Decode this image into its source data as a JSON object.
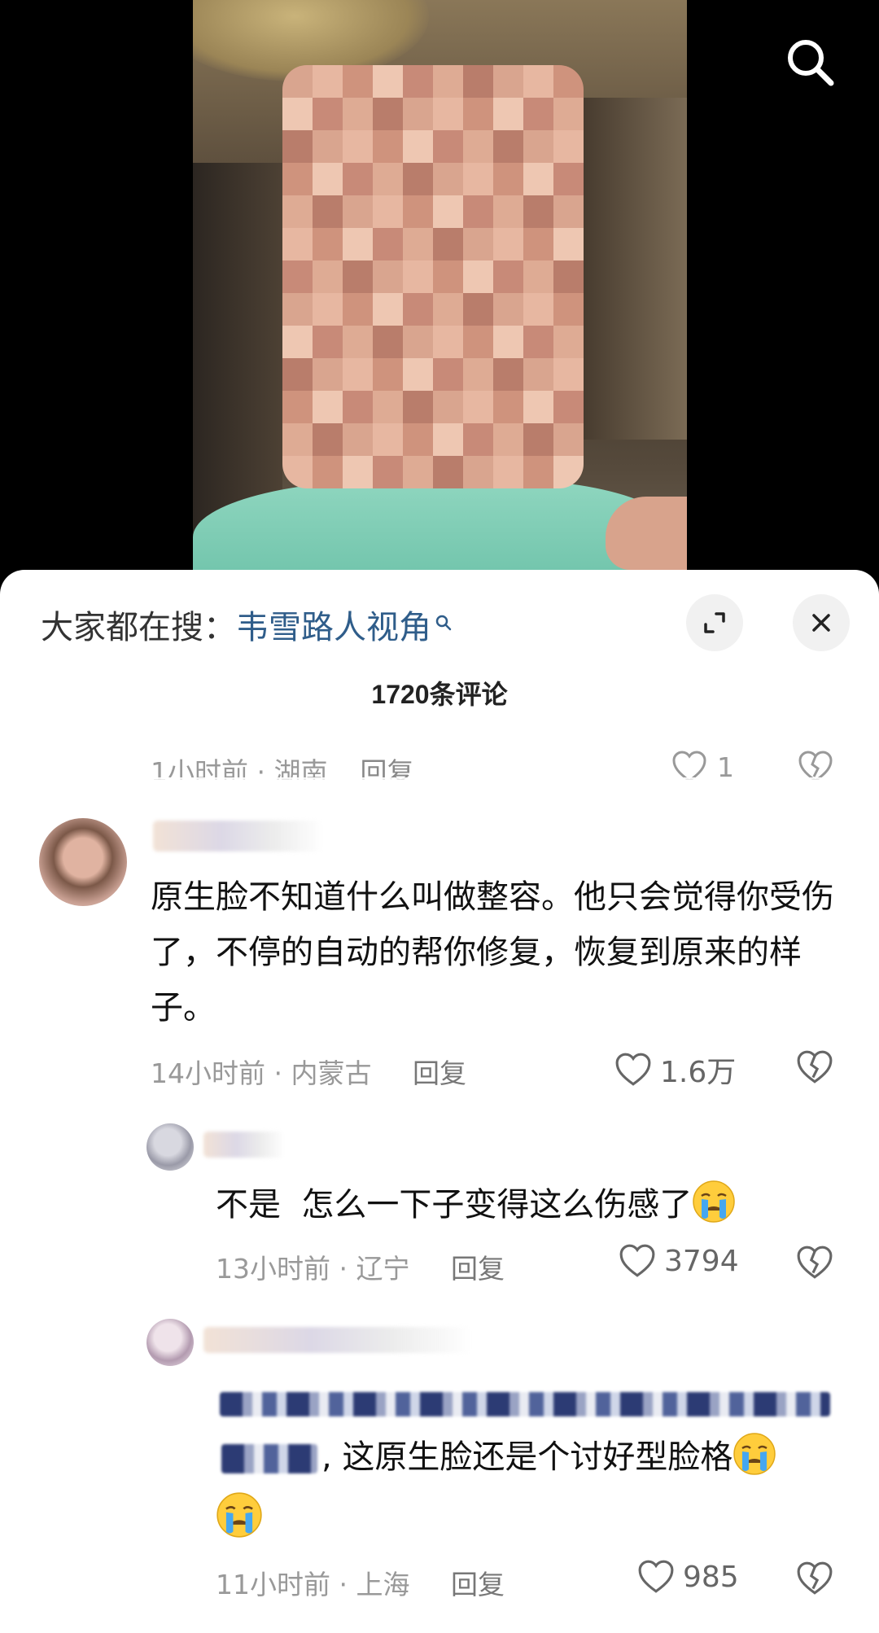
{
  "header": {
    "search_icon": "search-icon"
  },
  "panel": {
    "suggest_prefix": "大家都在搜：",
    "suggest_keyword": "韦雪路人视角",
    "title": "1720条评论",
    "expand_icon": "expand-icon",
    "close_icon": "close-icon"
  },
  "prev_comment_meta": {
    "time_loc": "1小时前 · 湖南",
    "reply": "回复",
    "likes": "1"
  },
  "comments": [
    {
      "text": "原生脸不知道什么叫做整容。他只会觉得你受伤了，不停的自动的帮你修复，恢复到原来的样子。",
      "time_loc": "14小时前 · 内蒙古",
      "reply": "回复",
      "likes": "1.6万",
      "replies": [
        {
          "text": "不是  怎么一下子变得这么伤感了",
          "emoji": "crying-face",
          "time_loc": "13小时前 · 辽宁",
          "reply": "回复",
          "likes": "3794"
        },
        {
          "text": ", 这原生脸还是个讨好型脸格",
          "emoji": "crying-face",
          "time_loc": "11小时前 · 上海",
          "reply": "回复",
          "likes": "985"
        }
      ]
    }
  ],
  "colors": {
    "keyword": "#2f5d8a",
    "meta": "#999999",
    "text": "#111111"
  }
}
